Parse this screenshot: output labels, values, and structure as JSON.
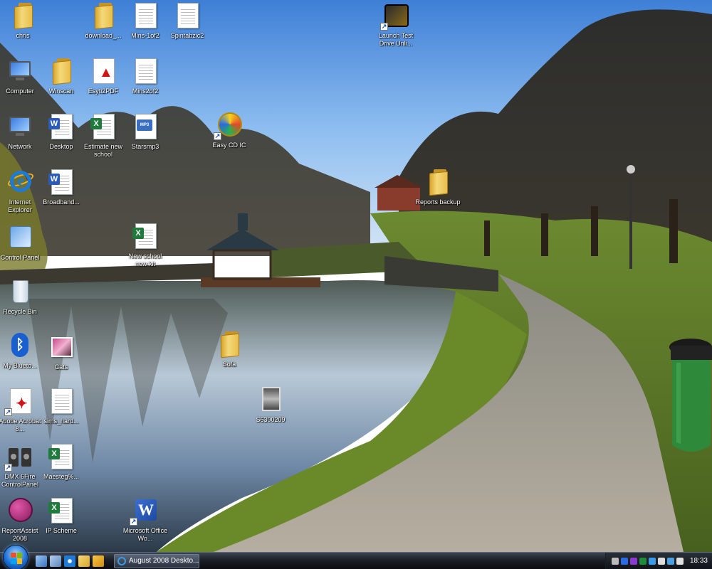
{
  "desktop": {
    "icons": [
      {
        "label": "chris"
      },
      {
        "label": "download_..."
      },
      {
        "label": "Mins-1of2"
      },
      {
        "label": "Spintabzic2"
      },
      {
        "label": "Launch Test Drive Unli..."
      },
      {
        "label": "Computer"
      },
      {
        "label": "Winscan"
      },
      {
        "label": "Esyti2PDF"
      },
      {
        "label": "Mins2of2"
      },
      {
        "label": "Network"
      },
      {
        "label": "Desktop"
      },
      {
        "label": "Estimate new school"
      },
      {
        "label": "Starsmp3"
      },
      {
        "label": "Easy CD IC"
      },
      {
        "label": "Internet Explorer"
      },
      {
        "label": "Broadband..."
      },
      {
        "label": "Reports backup"
      },
      {
        "label": "Control Panel"
      },
      {
        "label": "New school new kit"
      },
      {
        "label": "Recycle Bin"
      },
      {
        "label": "My Blueto..."
      },
      {
        "label": "Cats"
      },
      {
        "label": "Sofa"
      },
      {
        "label": "Adobe Acrobat 8..."
      },
      {
        "label": "sims_hard..."
      },
      {
        "label": "S6300209"
      },
      {
        "label": "DMX 6Fire ControlPanel"
      },
      {
        "label": "Maesteg%..."
      },
      {
        "label": "ReportAssist 2008"
      },
      {
        "label": "IP Scheme"
      },
      {
        "label": "Microsoft Office Wo..."
      }
    ]
  },
  "taskbar": {
    "active_window": "August 2008 Deskto...",
    "clock": "18:33"
  },
  "colors": {
    "sky": "#5d9be0",
    "taskbar": "#1b1f26",
    "grass": "#5f7d2a"
  }
}
